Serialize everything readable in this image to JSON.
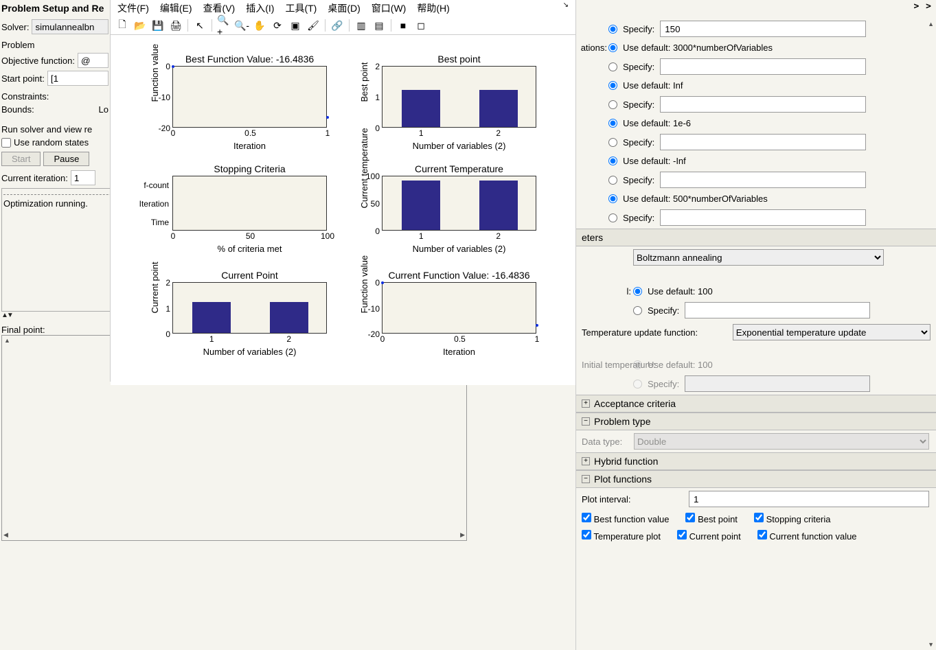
{
  "left": {
    "panelTitle": "Problem Setup and Re",
    "solverLabel": "Solver:",
    "solverValue": "simulannealbn",
    "problemHeader": "Problem",
    "objFuncLabel": "Objective function:",
    "objFuncValue": "@",
    "startPointLabel": "Start point:",
    "startPointValue": "[1",
    "constraintsLabel": "Constraints:",
    "boundsLabel": "Bounds:",
    "boundsVal": "Lo",
    "runHeader": "Run solver and view re",
    "randomStatesLabel": "Use random states",
    "startBtn": "Start",
    "pauseBtn": "Pause",
    "curIterLabel": "Current iteration:",
    "curIterVal": "1",
    "statusText": "Optimization running.",
    "finalPointLabel": "Final point:"
  },
  "figwin": {
    "menus": [
      "文件(F)",
      "编辑(E)",
      "查看(V)",
      "插入(I)",
      "工具(T)",
      "桌面(D)",
      "窗口(W)",
      "帮助(H)"
    ]
  },
  "chart_data": [
    {
      "id": "bfv",
      "type": "scatter",
      "title": "Best Function Value: -16.4836",
      "xlabel": "Iteration",
      "ylabel": "Function value",
      "xlim": [
        0,
        1
      ],
      "ylim": [
        -20,
        0
      ],
      "xticks": [
        0,
        0.5,
        1
      ],
      "yticks": [
        -20,
        -10,
        0
      ],
      "points": [
        {
          "x": 0,
          "y": 0
        },
        {
          "x": 1,
          "y": -16.48
        }
      ]
    },
    {
      "id": "bp",
      "type": "bar",
      "title": "Best point",
      "xlabel": "Number of variables (2)",
      "ylabel": "Best point",
      "ylim": [
        0,
        2
      ],
      "yticks": [
        0,
        1,
        2
      ],
      "categories": [
        "1",
        "2"
      ],
      "values": [
        1.2,
        1.2
      ]
    },
    {
      "id": "sc",
      "type": "hbar",
      "title": "Stopping Criteria",
      "xlabel": "% of criteria met",
      "ylabel": "",
      "xlim": [
        0,
        100
      ],
      "xticks": [
        0,
        50,
        100
      ],
      "rowlabels": [
        "f-count",
        "Iteration",
        "Time"
      ],
      "values": [
        0,
        0,
        0
      ]
    },
    {
      "id": "ct",
      "type": "bar",
      "title": "Current Temperature",
      "xlabel": "Number of variables (2)",
      "ylabel": "Current temperature",
      "ylim": [
        0,
        100
      ],
      "yticks": [
        0,
        50,
        100
      ],
      "categories": [
        "1",
        "2"
      ],
      "values": [
        90,
        90
      ]
    },
    {
      "id": "cp",
      "type": "bar",
      "title": "Current Point",
      "xlabel": "Number of variables (2)",
      "ylabel": "Current point",
      "ylim": [
        0,
        2
      ],
      "yticks": [
        0,
        1,
        2
      ],
      "categories": [
        "1",
        "2"
      ],
      "values": [
        1.2,
        1.2
      ]
    },
    {
      "id": "cfv",
      "type": "scatter",
      "title": "Current Function Value: -16.4836",
      "xlabel": "Iteration",
      "ylabel": "Function value",
      "xlim": [
        0,
        1
      ],
      "ylim": [
        -20,
        0
      ],
      "xticks": [
        0,
        0.5,
        1
      ],
      "yticks": [
        -20,
        -10,
        0
      ],
      "points": [
        {
          "x": 0,
          "y": 0
        },
        {
          "x": 1,
          "y": -16.48
        }
      ]
    }
  ],
  "right": {
    "chev": "> >",
    "line1": {
      "specifyLabel": "Specify:",
      "specifyValue": "150"
    },
    "iterationsLabel": "ations:",
    "iterationsDefault": "Use default: 3000*numberOfVariables",
    "specifyLabel": "Specify:",
    "infDefault": "Use default: Inf",
    "tolDefault": "Use default: 1e-6",
    "negInfDefault": "Use default: -Inf",
    "stallDefault": "Use default: 500*numberOfVariables",
    "parametersHeader": "eters",
    "annealSelectLabel": "",
    "annealingSelectValue": "Boltzmann annealing",
    "intervalSuffix": "l:",
    "intervalDefault": "Use default: 100",
    "tempUpdateLabel": "Temperature update function:",
    "tempUpdateValue": "Exponential temperature update",
    "initTempLabel": "Initial temperature:",
    "initTempDefault": "Use default: 100",
    "acceptHeader": "Acceptance criteria",
    "problemTypeHeader": "Problem type",
    "dataTypeLabel": "Data type:",
    "dataTypeValue": "Double",
    "hybridHeader": "Hybrid function",
    "plotFuncHeader": "Plot functions",
    "plotIntervalLabel": "Plot interval:",
    "plotIntervalValue": "1",
    "cb": {
      "bfv": "Best function value",
      "bp": "Best point",
      "sc": "Stopping criteria",
      "tp": "Temperature plot",
      "cp": "Current point",
      "cfv": "Current function value"
    }
  }
}
